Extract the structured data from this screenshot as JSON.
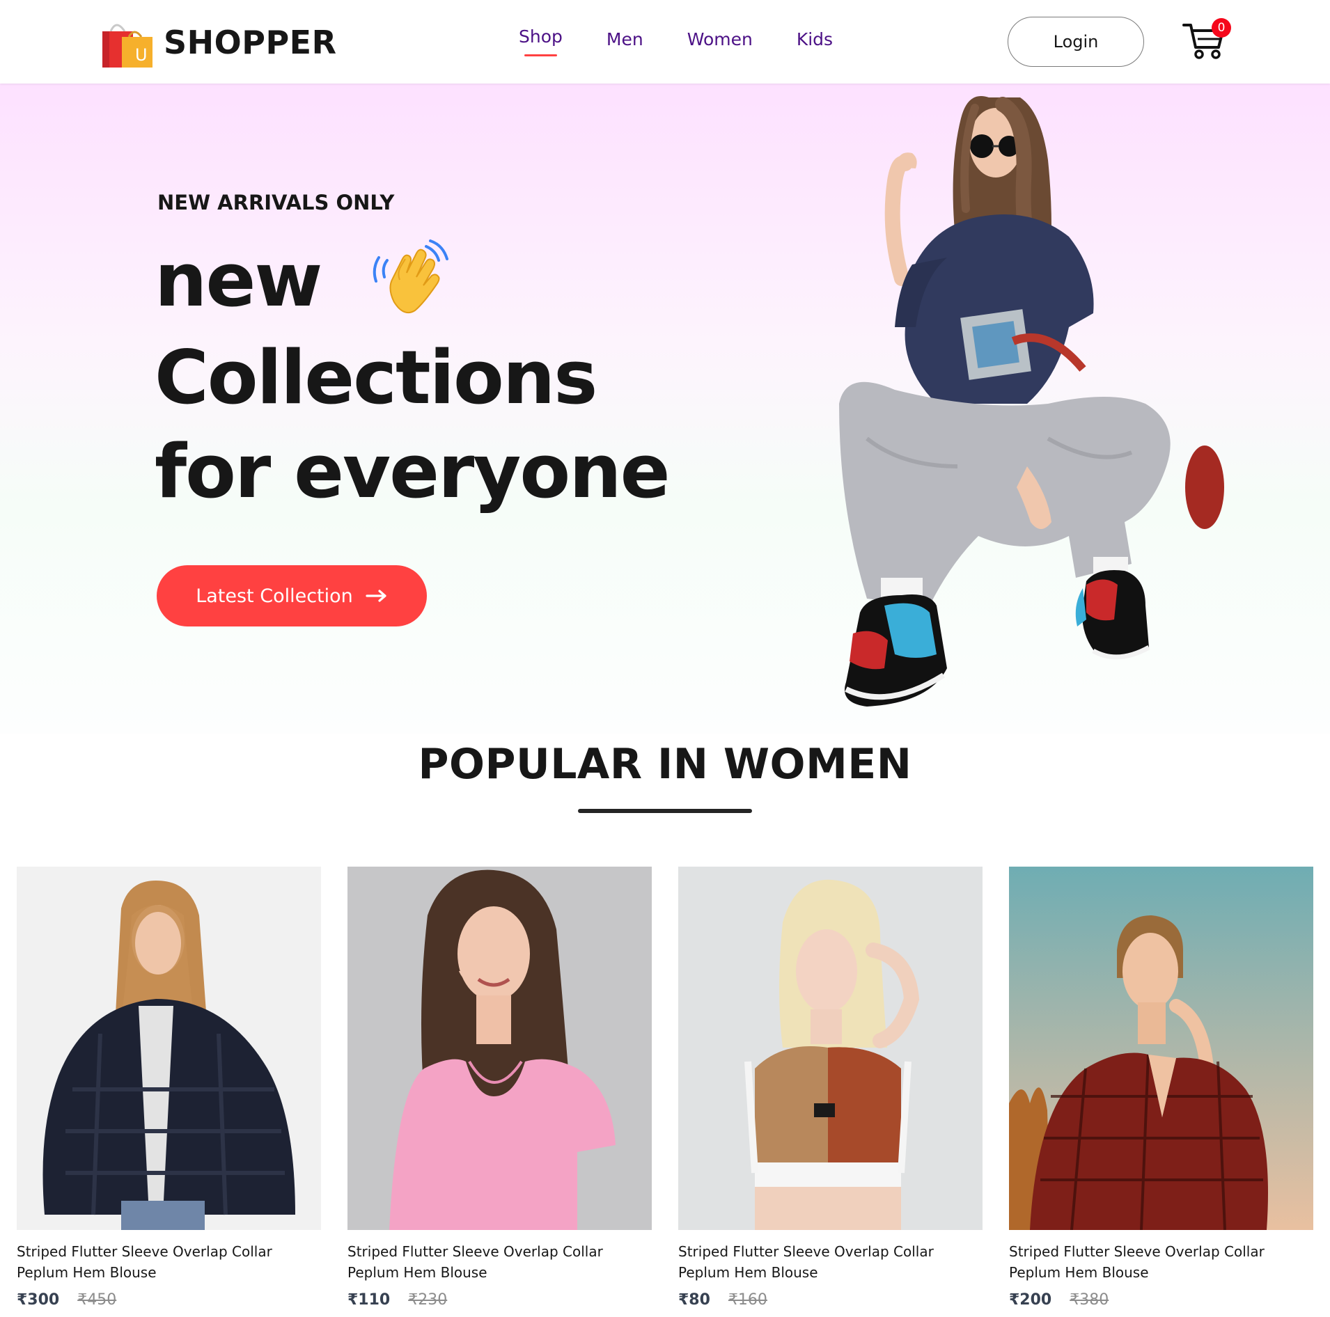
{
  "brand": {
    "name": "SHOPPER",
    "logo_icon": "shopping-bags-icon",
    "logo_letter": "U"
  },
  "nav": {
    "items": [
      {
        "label": "Shop",
        "active": true
      },
      {
        "label": "Men",
        "active": false
      },
      {
        "label": "Women",
        "active": false
      },
      {
        "label": "Kids",
        "active": false
      }
    ],
    "active_underline_color": "#ff4141"
  },
  "header": {
    "login_label": "Login",
    "cart_icon": "cart-icon",
    "cart_count": "0"
  },
  "hero": {
    "eyebrow": "NEW ARRIVALS ONLY",
    "line1": "new",
    "line2": "Collections",
    "line3": "for everyone",
    "hand_icon": "waving-hand-icon",
    "cta_label": "Latest Collection",
    "cta_icon": "arrow-right-icon",
    "cta_color": "#ff4141"
  },
  "popular": {
    "title": "POPULAR IN WOMEN",
    "products": [
      {
        "name": "Striped Flutter Sleeve Overlap Collar Peplum Hem Blouse",
        "new_price": "₹300",
        "old_price": "₹450"
      },
      {
        "name": "Striped Flutter Sleeve Overlap Collar Peplum Hem Blouse",
        "new_price": "₹110",
        "old_price": "₹230"
      },
      {
        "name": "Striped Flutter Sleeve Overlap Collar Peplum Hem Blouse",
        "new_price": "₹80",
        "old_price": "₹160"
      },
      {
        "name": "Striped Flutter Sleeve Overlap Collar Peplum Hem Blouse",
        "new_price": "₹200",
        "old_price": "₹380"
      }
    ]
  }
}
